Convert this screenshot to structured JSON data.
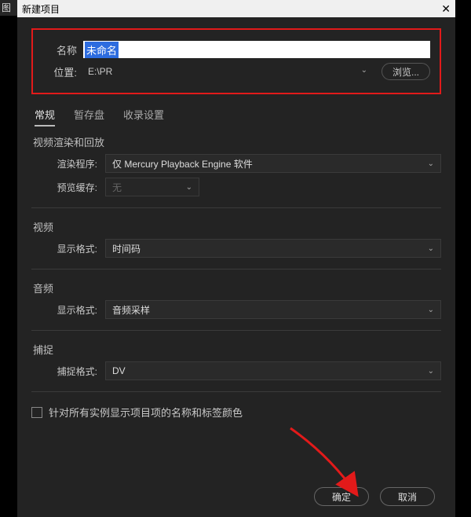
{
  "left_sliver": "图",
  "titlebar": {
    "title": "新建项目",
    "close": "✕"
  },
  "top": {
    "name_label": "名称",
    "name_value": "未命名",
    "location_label": "位置:",
    "location_value": "E:\\PR",
    "browse_label": "浏览..."
  },
  "tabs": {
    "t1": "常规",
    "t2": "暂存盘",
    "t3": "收录设置"
  },
  "sections": {
    "render": {
      "title": "视频渲染和回放",
      "renderer_label": "渲染程序:",
      "renderer_value": "仅 Mercury Playback Engine 软件",
      "cache_label": "预览缓存:",
      "cache_value": "无"
    },
    "video": {
      "title": "视频",
      "format_label": "显示格式:",
      "format_value": "时间码"
    },
    "audio": {
      "title": "音频",
      "format_label": "显示格式:",
      "format_value": "音频采样"
    },
    "capture": {
      "title": "捕捉",
      "format_label": "捕捉格式:",
      "format_value": "DV"
    }
  },
  "checkbox_label": "针对所有实例显示项目项的名称和标签颜色",
  "footer": {
    "ok": "确定",
    "cancel": "取消"
  }
}
